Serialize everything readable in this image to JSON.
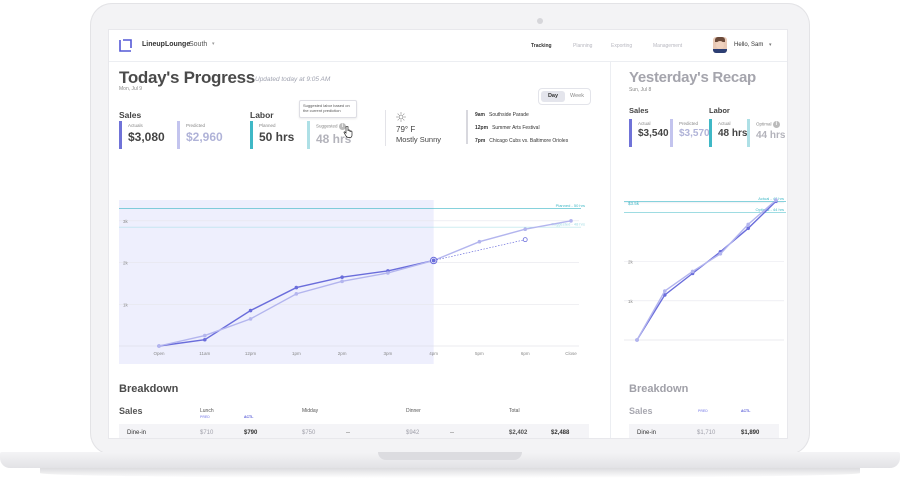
{
  "nav": {
    "brand": "LineupLounge",
    "location": "South",
    "tabs": [
      "Tracking",
      "Planning",
      "Exporting",
      "Management"
    ],
    "active_tab": "Tracking",
    "greeting": "Hello, Sam"
  },
  "today": {
    "title": "Today's Progress",
    "updated": "Updated today at 9:05 AM",
    "date": "Mon, Jul 9",
    "toggle": {
      "day": "Day",
      "week": "Week"
    },
    "sales": {
      "heading": "Sales",
      "actuals_label": "Actuals",
      "actuals_value": "$3,080",
      "predicted_label": "Predicted",
      "predicted_value": "$2,960"
    },
    "labor": {
      "heading": "Labor",
      "planned_label": "Planned",
      "planned_value": "50 hrs",
      "suggested_label": "Suggested",
      "suggested_value": "48 hrs",
      "tooltip": "Suggested labor based on the current prediction"
    },
    "weather": {
      "icon": "sun-icon",
      "temp": "79° F",
      "condition": "Mostly Sunny"
    },
    "events": [
      {
        "time": "9am",
        "name": "Southside Parade"
      },
      {
        "time": "12pm",
        "name": "Summer Arts Festival"
      },
      {
        "time": "7pm",
        "name": "Chicago Cubs vs. Baltimore Orioles"
      }
    ]
  },
  "yesterday": {
    "title": "Yesterday's Recap",
    "date": "Sun, Jul 8",
    "sales": {
      "heading": "Sales",
      "actual_label": "Actual",
      "actual_value": "$3,540",
      "predicted_label": "Predicted",
      "predicted_value": "$3,570"
    },
    "labor": {
      "heading": "Labor",
      "actual_label": "Actual",
      "actual_value": "48 hrs",
      "optimal_label": "Optimal",
      "optimal_value": "44 hrs"
    }
  },
  "chart_data": [
    {
      "type": "line",
      "x": [
        "Open",
        "11am",
        "12pm",
        "1pm",
        "2pm",
        "3pm",
        "4pm",
        "5pm",
        "6pm",
        "Close"
      ],
      "yticks": [
        "1k",
        "2k",
        "3k"
      ],
      "ylim": [
        0,
        3500
      ],
      "series": [
        {
          "values": [
            0,
            150,
            850,
            1400,
            1650,
            1800,
            2050,
            null,
            null,
            null
          ],
          "color": "#6a6ddb"
        },
        {
          "values": [
            0,
            250,
            650,
            1250,
            1550,
            1750,
            2050,
            2500,
            2800,
            3000
          ],
          "color": "#b3b5ee"
        },
        {
          "values": [
            null,
            null,
            null,
            null,
            null,
            null,
            2050,
            2300,
            2550,
            null
          ],
          "color": "#6a6ddb",
          "style": "dashed"
        }
      ],
      "reference_lines": [
        {
          "label": "Planned - 50 hrs",
          "value": 3300,
          "color": "#3fb8c6"
        },
        {
          "label": "Suggested - 48 hrs",
          "value": 2850,
          "color": "#9fdbe3"
        }
      ],
      "highlight": {
        "from": "Open",
        "to": "4pm"
      }
    },
    {
      "type": "line",
      "x": [
        "Open",
        "12pm",
        "2pm",
        "4pm",
        "6pm",
        "Close"
      ],
      "yticks": [
        "1k",
        "2k",
        "$3.5k"
      ],
      "ylim": [
        0,
        3700
      ],
      "series": [
        {
          "values": [
            0,
            1150,
            1700,
            2250,
            2850,
            3540
          ],
          "color": "#6a6ddb"
        },
        {
          "values": [
            0,
            1250,
            1750,
            2200,
            2950,
            3570
          ],
          "color": "#b3b5ee"
        }
      ],
      "reference_lines": [
        {
          "label": "Actual - 48 hrs",
          "value": 3540,
          "color": "#3fb8c6"
        },
        {
          "label": "Optimal - 44 hrs",
          "value": 3250,
          "color": "#3fb8c6"
        }
      ]
    }
  ],
  "breakdown": {
    "title": "Breakdown",
    "sales_heading": "Sales",
    "columns": [
      "Lunch",
      "Midday",
      "Dinner",
      "Total"
    ],
    "pred_label": "PRED",
    "actl_label": "ACTL",
    "rows": [
      {
        "label": "Dine-in",
        "lunch_pred": "$710",
        "lunch_actl": "$790",
        "midday_pred": "$750",
        "midday_actl": "--",
        "dinner_pred": "$942",
        "dinner_actl": "--",
        "total_pred": "$2,402",
        "total_actl": "$2,488"
      }
    ],
    "recap_rows": [
      {
        "label": "Dine-in",
        "pred": "$1,710",
        "actl": "$1,890"
      }
    ]
  }
}
